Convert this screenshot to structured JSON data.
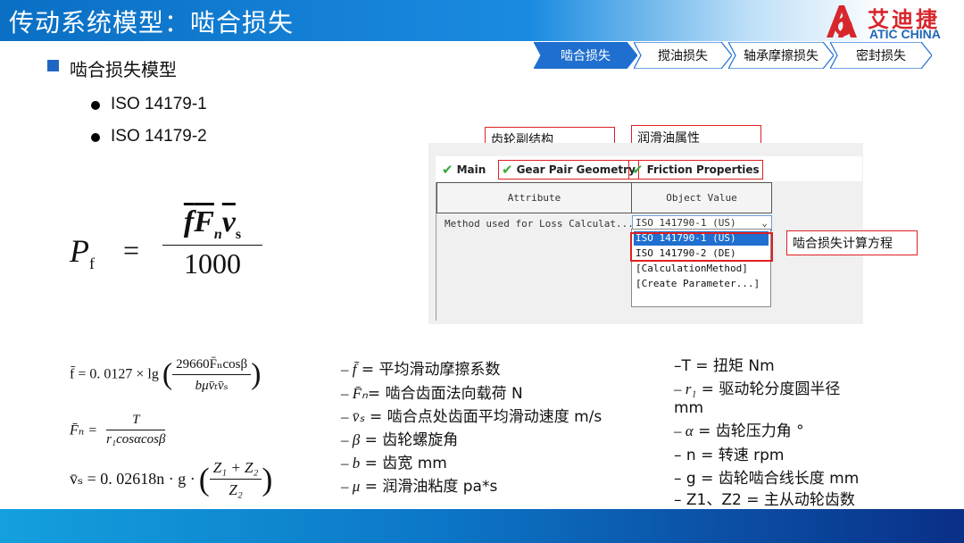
{
  "header": {
    "title": "传动系统模型：啮合损失",
    "logo_cn": "艾迪捷",
    "logo_en": "ATIC CHINA"
  },
  "tabs": [
    {
      "label": "啮合损失",
      "active": true
    },
    {
      "label": "搅油损失",
      "active": false
    },
    {
      "label": "轴承摩擦损失",
      "active": false
    },
    {
      "label": "密封损失",
      "active": false
    }
  ],
  "section": {
    "heading": "啮合损失模型",
    "items": [
      "ISO 14179-1",
      "ISO 14179-2"
    ]
  },
  "main_formula": {
    "lhs_sym": "P",
    "lhs_sub": "f",
    "eq": "=",
    "num_f": "f",
    "num_F": "F",
    "num_F_sub": "n",
    "num_v": "ν",
    "num_v_sub": "s",
    "den": "1000"
  },
  "software": {
    "tabs": [
      {
        "label": "Main"
      },
      {
        "label": "Gear Pair Geometry"
      },
      {
        "label": "Friction Properties"
      }
    ],
    "col_attribute": "Attribute",
    "col_value": "Object Value",
    "row_attribute": "Method used for Loss Calculat...",
    "row_value": "ISO 141790-1 (US)",
    "dropdown_arrow": "⌄",
    "options": [
      "ISO 141790-1 (US)",
      "ISO 141790-2 (DE)",
      "[CalculationMethod]",
      "[Create Parameter...]"
    ],
    "callout_structure": "齿轮副结构",
    "callout_oil": "润滑油属性",
    "callout_method": "啮合损失计算方程"
  },
  "formulas": {
    "f_lhs": "f̄ = 0. 0127 × lg",
    "f_num": "29660F̄ₙcosβ",
    "f_den": "bμv̄ₜv̄ₛ",
    "Fn_lhs": "F̄ₙ =",
    "Fn_num": "T",
    "Fn_den": "r₁cosαcosβ",
    "vs_lhs": "v̄ₛ = 0. 02618n · g ·",
    "vs_num": "Z₁ + Z₂",
    "vs_den": "Z₂"
  },
  "definitions_mid": [
    {
      "sym": "– f̄",
      "text": " = 平均滑动摩擦系数"
    },
    {
      "sym": "– F̄ₙ",
      "text": "= 啮合齿面法向载荷 N"
    },
    {
      "sym": "– v̄ₛ",
      "text": " = 啮合点处齿面平均滑动速度 m/s"
    },
    {
      "sym": "– β",
      "text": " = 齿轮螺旋角"
    },
    {
      "sym": "– b",
      "text": " = 齿宽 mm"
    },
    {
      "sym": "– μ",
      "text": " = 润滑油粘度 pa*s"
    }
  ],
  "definitions_right": [
    {
      "sym": "–T",
      "text": " = 扭矩 Nm"
    },
    {
      "sym": "– r₁",
      "text": "  = 驱动轮分度圆半径"
    },
    {
      "sym": "",
      "text": "mm"
    },
    {
      "sym": "– α",
      "text": "  = 齿轮压力角 °"
    },
    {
      "sym": "– n",
      "text": " = 转速 rpm"
    },
    {
      "sym": "– g",
      "text": " = 齿轮啮合线长度 mm"
    },
    {
      "sym": "– Z1、Z2",
      "text": " = 主从动轮齿数"
    }
  ],
  "colors": {
    "title_blue": "#0a6fc4",
    "accent_red": "#e02020",
    "logo_red": "#d7262c",
    "tab_active": "#1f6fd0"
  }
}
